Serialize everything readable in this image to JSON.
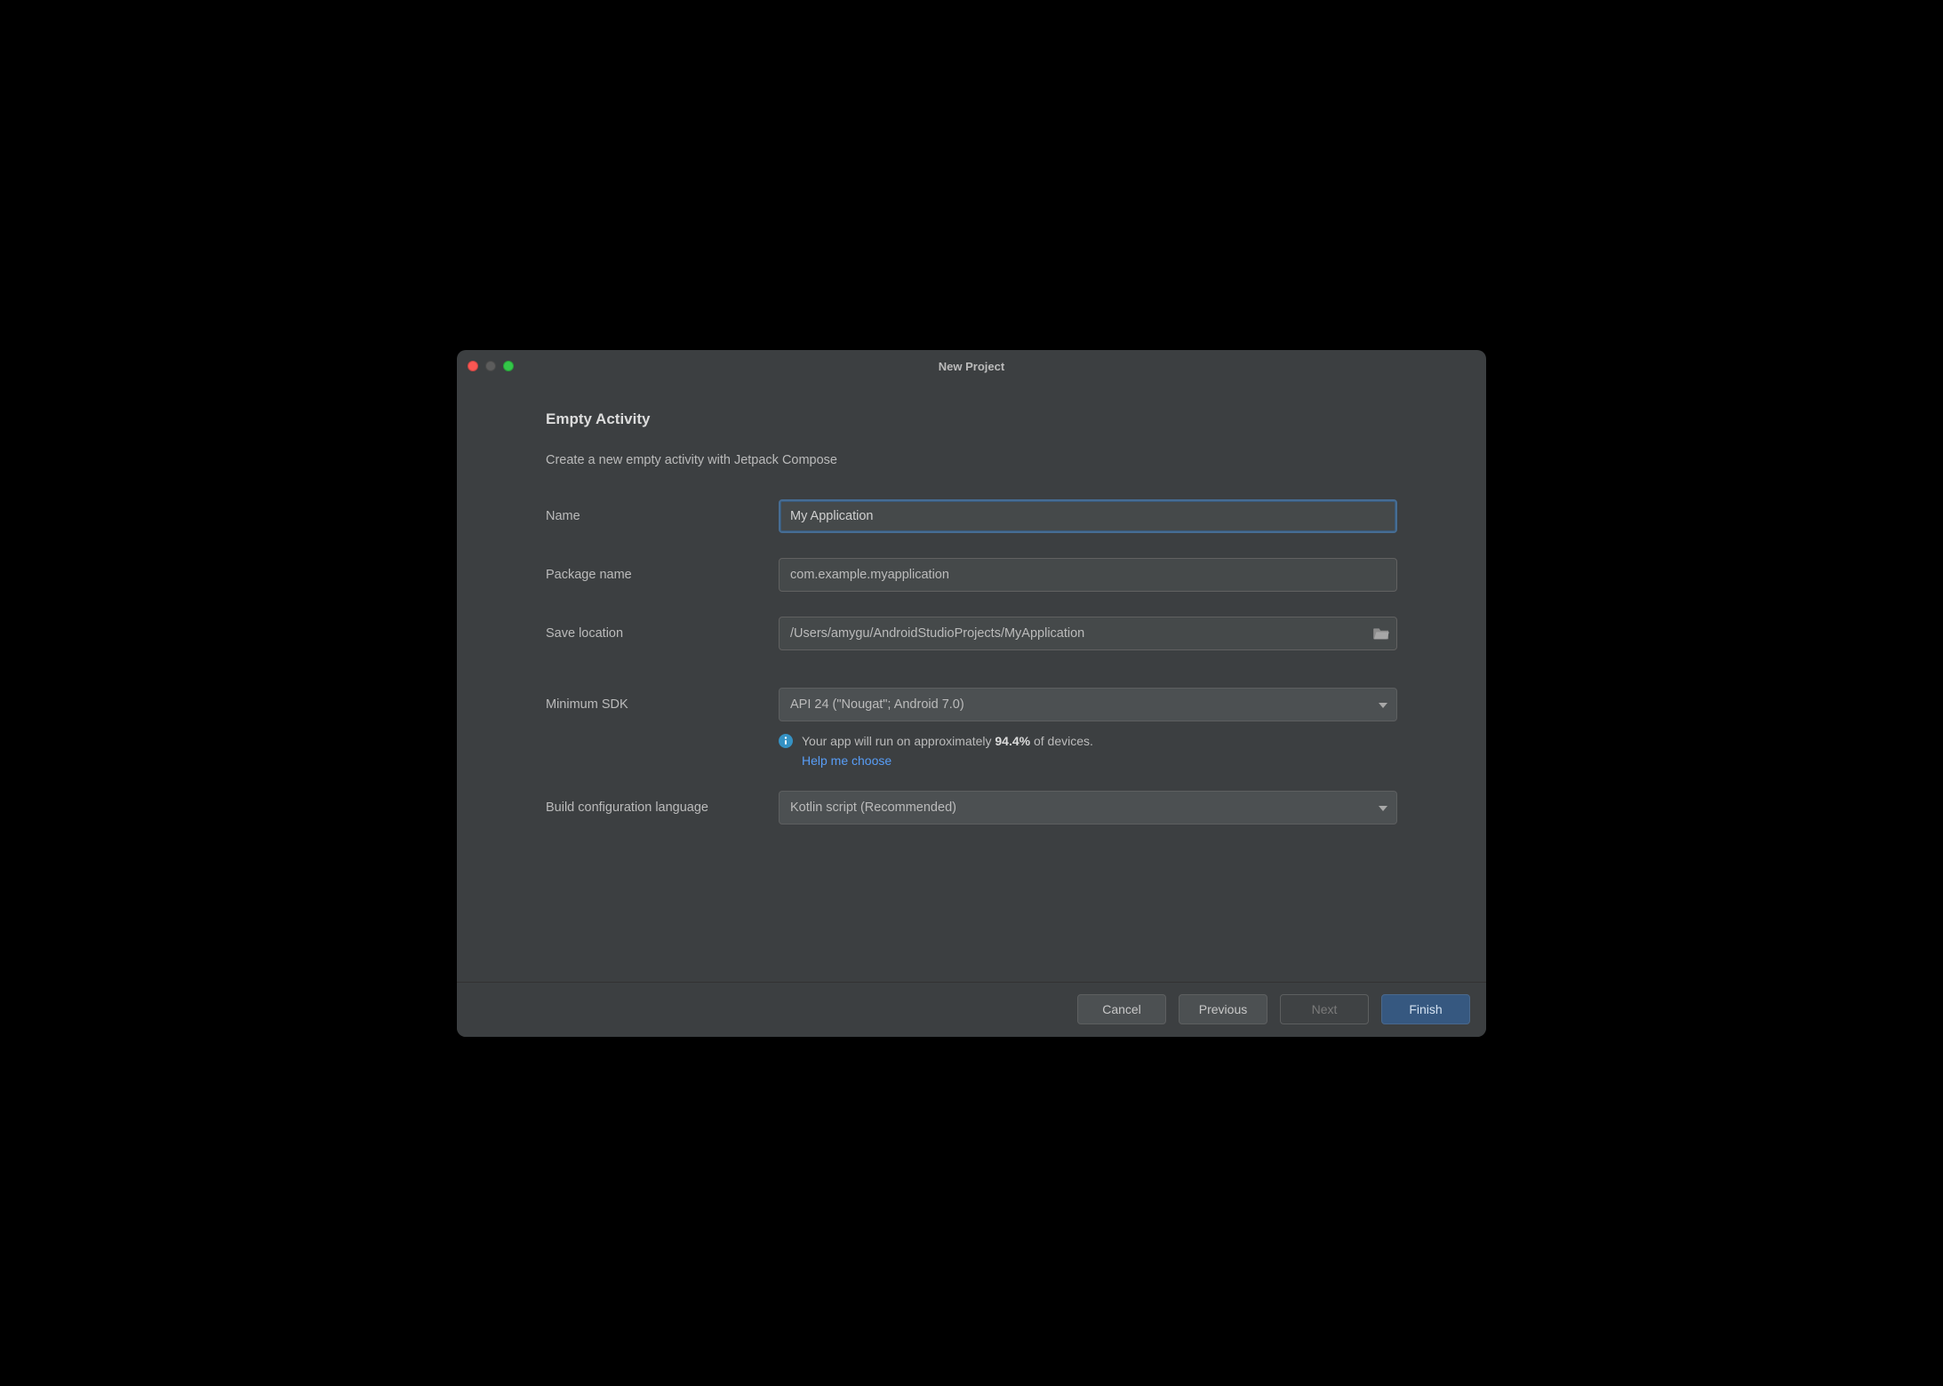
{
  "window": {
    "title": "New Project"
  },
  "heading": "Empty Activity",
  "subheading": "Create a new empty activity with Jetpack Compose",
  "form": {
    "name": {
      "label": "Name",
      "value": "My Application"
    },
    "package_name": {
      "label": "Package name",
      "value": "com.example.myapplication"
    },
    "save_location": {
      "label": "Save location",
      "value": "/Users/amygu/AndroidStudioProjects/MyApplication"
    },
    "minimum_sdk": {
      "label": "Minimum SDK",
      "value": "API 24 (\"Nougat\"; Android 7.0)"
    },
    "build_lang": {
      "label": "Build configuration language",
      "value": "Kotlin script (Recommended)"
    }
  },
  "info": {
    "prefix": "Your app will run on approximately ",
    "percent": "94.4%",
    "suffix": " of devices.",
    "help_link": "Help me choose"
  },
  "buttons": {
    "cancel": "Cancel",
    "previous": "Previous",
    "next": "Next",
    "finish": "Finish"
  }
}
